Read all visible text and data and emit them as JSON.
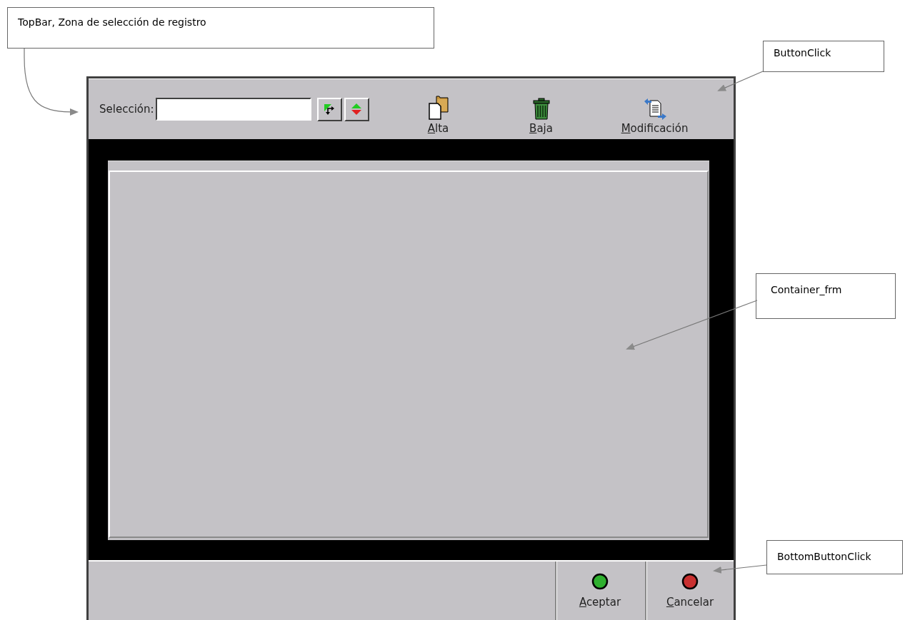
{
  "callouts": [
    {
      "text": "TopBar, Zona de selección de registro"
    },
    {
      "text": "ButtonClick"
    },
    {
      "text": "Container_frm"
    },
    {
      "text": "BottomButtonClick"
    }
  ],
  "top_bar": {
    "selection_label": "Selección:",
    "tools": [
      {
        "kind": "jump"
      },
      {
        "kind": "updown"
      }
    ],
    "actions": [
      {
        "kind": "add",
        "label": "Alta",
        "underline_first": true
      },
      {
        "kind": "delete",
        "label": "Baja",
        "underline_first": true
      },
      {
        "kind": "modify",
        "label": "Modificación",
        "underline_first": true
      }
    ]
  },
  "bottom_bar": {
    "buttons": [
      {
        "kind": "accept",
        "label": "Aceptar",
        "underline_first": true
      },
      {
        "kind": "cancel",
        "label": "Cancelar",
        "underline_first": true
      }
    ]
  }
}
